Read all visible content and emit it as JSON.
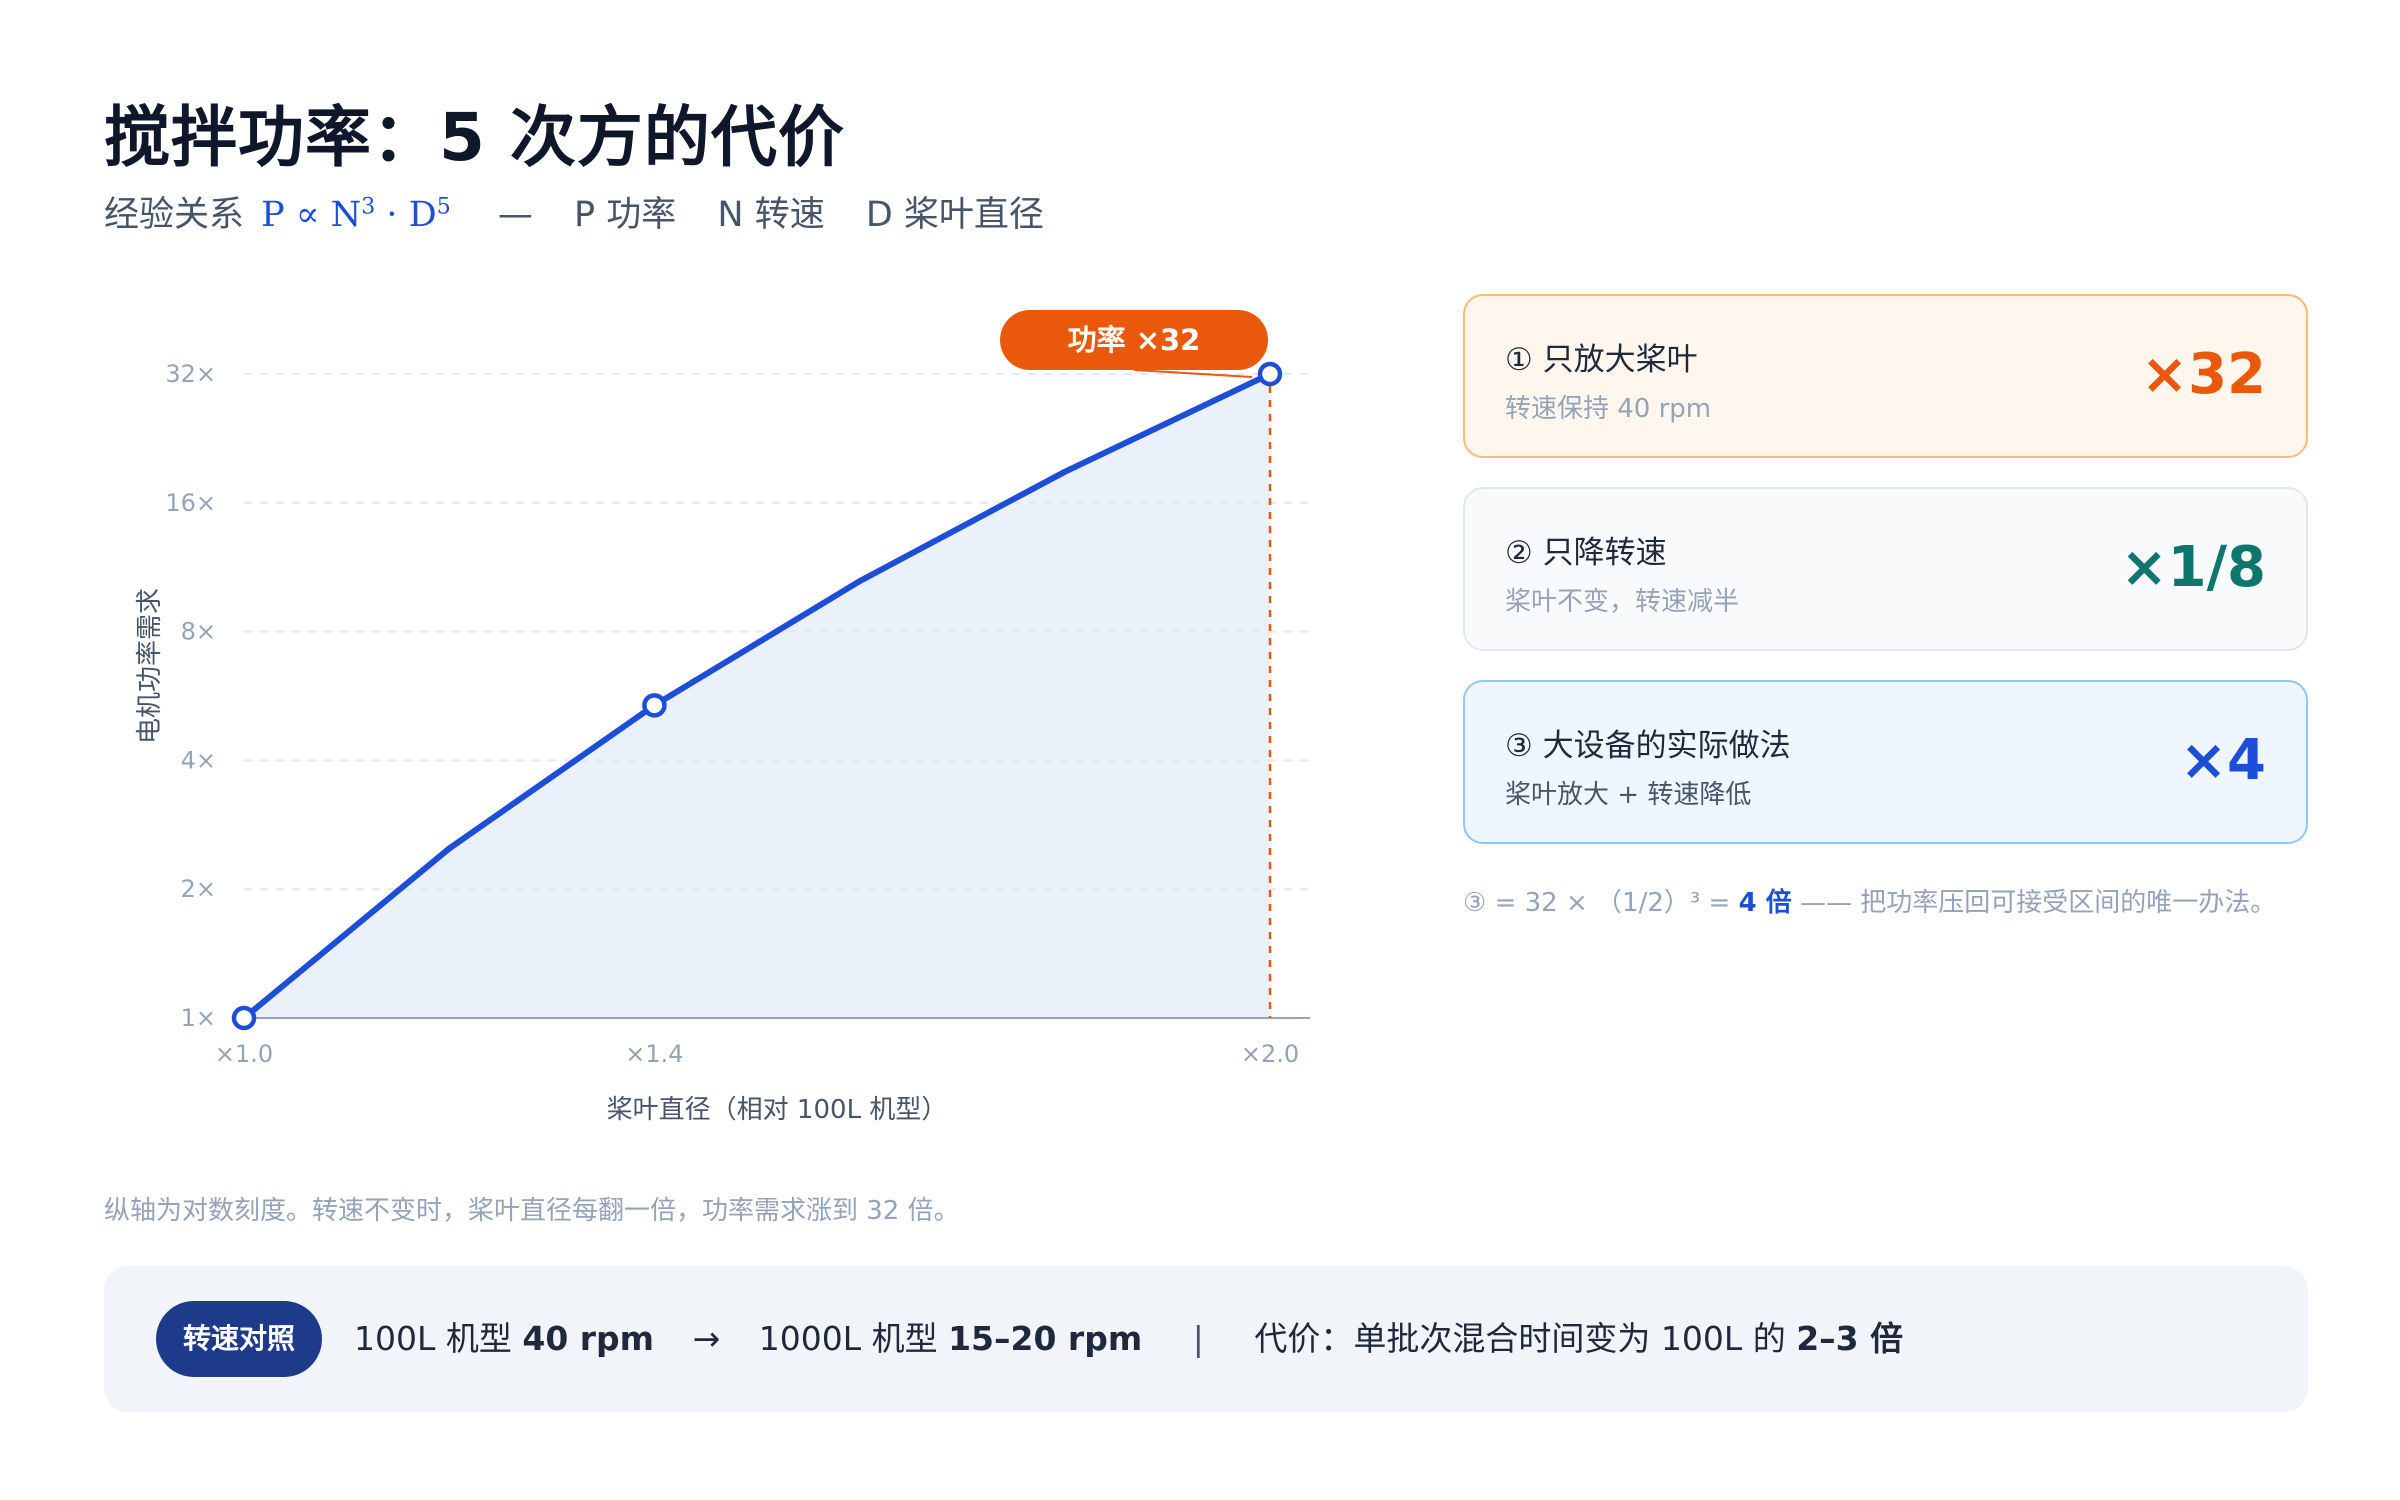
{
  "header": {
    "title": "搅拌功率：5 次方的代价",
    "subtitle_prefix": "经验关系",
    "formula_p": "P ∝ N",
    "formula_exp1": "3",
    "formula_mid": " · D",
    "formula_exp2": "5",
    "dash": "—",
    "legend_p": "P 功率",
    "legend_n": "N 转速",
    "legend_d": "D 桨叶直径"
  },
  "chart_data": {
    "type": "area",
    "x": [
      1.0,
      1.2,
      1.4,
      1.6,
      1.8,
      2.0
    ],
    "y": [
      1,
      2.49,
      5.38,
      10.49,
      18.9,
      32
    ],
    "marked_points": [
      1.0,
      1.4,
      2.0
    ],
    "xlim": [
      1.0,
      2.0
    ],
    "ylim": [
      1,
      32
    ],
    "y_scale": "log2",
    "x_ticks": [
      "×1.0",
      "×1.4",
      "×2.0"
    ],
    "x_tick_values": [
      1.0,
      1.4,
      2.0
    ],
    "y_ticks": [
      "1×",
      "2×",
      "4×",
      "8×",
      "16×",
      "32×"
    ],
    "y_tick_values": [
      1,
      2,
      4,
      8,
      16,
      32
    ],
    "xlabel": "桨叶直径（相对 100L 机型）",
    "ylabel": "电机功率需求",
    "grid": true,
    "annotation": {
      "text": "功率 ×32",
      "x": 2.0,
      "y": 32
    },
    "colors": {
      "line": "#1d4ed8",
      "area": "#dbe5f7",
      "annotation": "#ea580c"
    }
  },
  "cards": [
    {
      "title": "① 只放大桨叶",
      "desc": "转速保持 40 rpm",
      "value": "×32"
    },
    {
      "title": "② 只降转速",
      "desc": "桨叶不变，转速减半",
      "value": "×1/8"
    },
    {
      "title": "③ 大设备的实际做法",
      "desc": "桨叶放大 + 转速降低",
      "value": "×4"
    }
  ],
  "note": {
    "prefix": "③ = 32 × （1/2）³ = ",
    "highlight": "4 倍",
    "suffix": " —— 把功率压回可接受区间的唯一办法。"
  },
  "footnote": "纵轴为对数刻度。转速不变时，桨叶直径每翻一倍，功率需求涨到 32 倍。",
  "bottom_bar": {
    "pill": "转速对照",
    "small_label": "100L 机型",
    "small_value": "40 rpm",
    "arrow": "→",
    "large_label": "1000L 机型",
    "large_value": "15–20 rpm",
    "pipe": "|",
    "cost_label": "代价：单批次混合时间变为 100L 的",
    "cost_value": "2–3 倍"
  },
  "colors": {
    "title": "#0f172a",
    "accent_blue": "#1d4ed8",
    "accent_orange": "#ea580c",
    "accent_teal": "#0f766e",
    "pill_bg": "#1e3a8a"
  }
}
